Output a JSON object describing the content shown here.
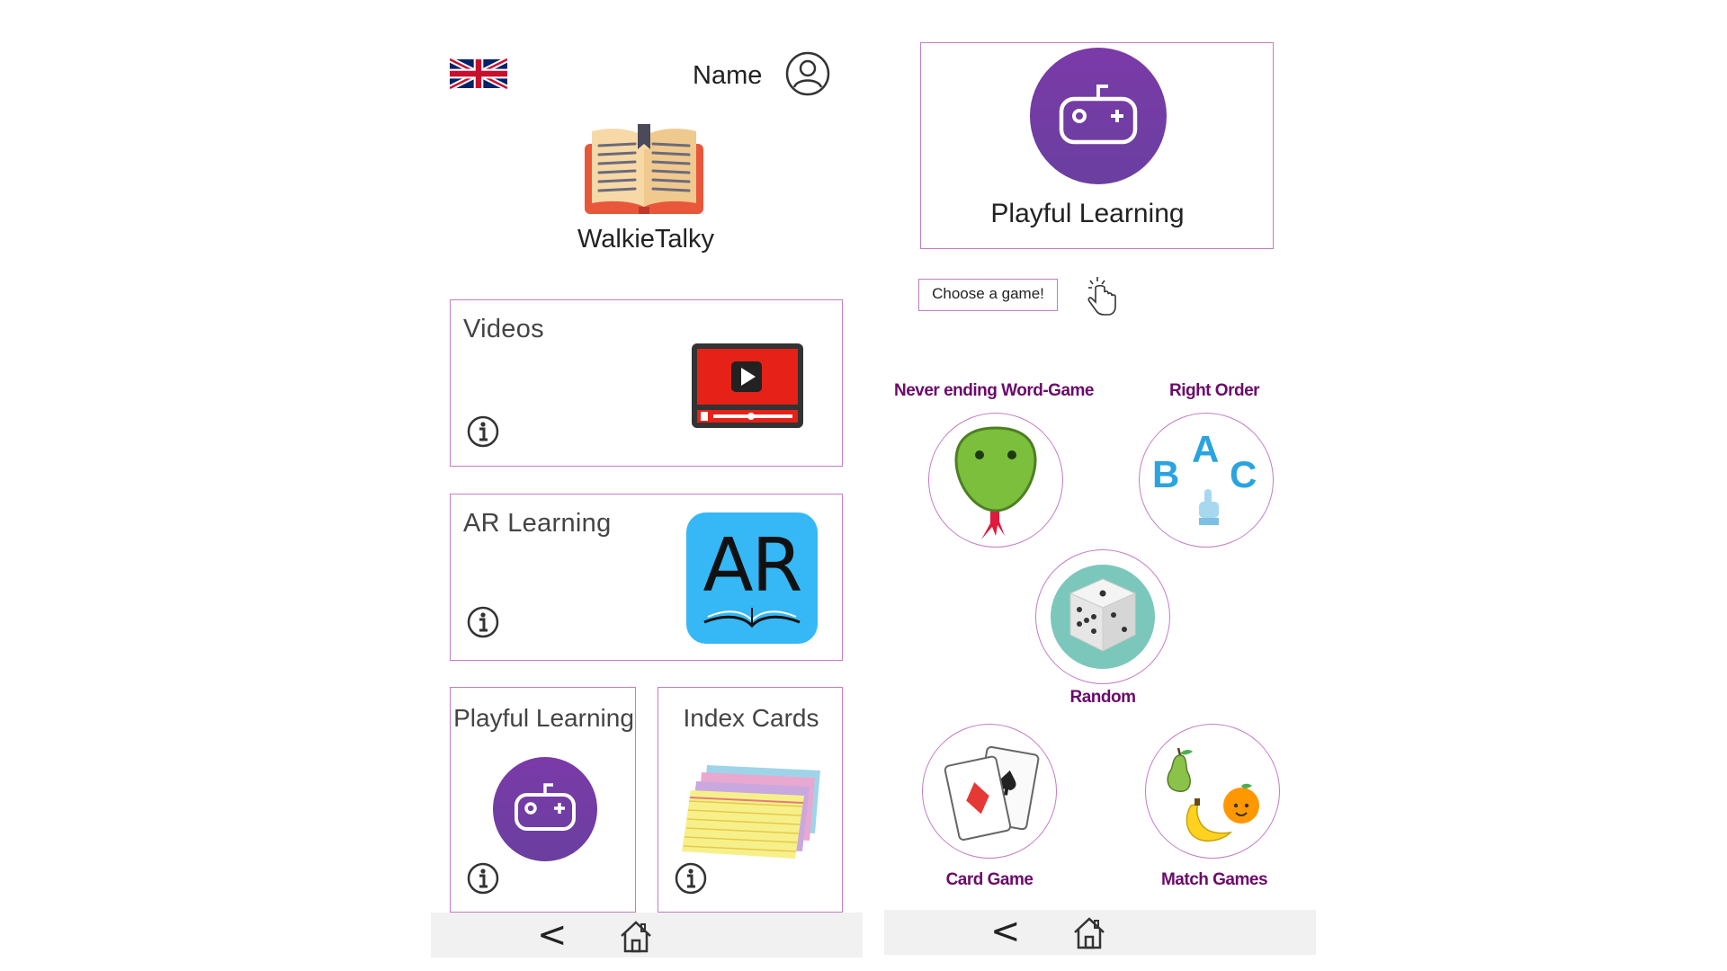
{
  "left": {
    "profile_name": "Name",
    "app_title": "WalkieTalky",
    "cards": {
      "videos": "Videos",
      "ar": "AR Learning",
      "ar_icon_text": "AR",
      "playful": "Playful Learning",
      "index": "Index Cards"
    },
    "nav": {
      "back": "<"
    }
  },
  "right": {
    "header_title": "Playful Learning",
    "choose_prompt": "Choose a game!",
    "games": {
      "word": "Never ending Word-Game",
      "order": "Right Order",
      "random": "Random",
      "card": "Card Game",
      "match": "Match Games"
    },
    "order_letters": {
      "a": "A",
      "b": "B",
      "c": "C"
    },
    "nav": {
      "back": "<"
    }
  },
  "colors": {
    "border": "#c47cc6",
    "purple": "#6f3ba0",
    "label_purple": "#6b0a6b",
    "nav_bar": "#f1f1f1"
  }
}
